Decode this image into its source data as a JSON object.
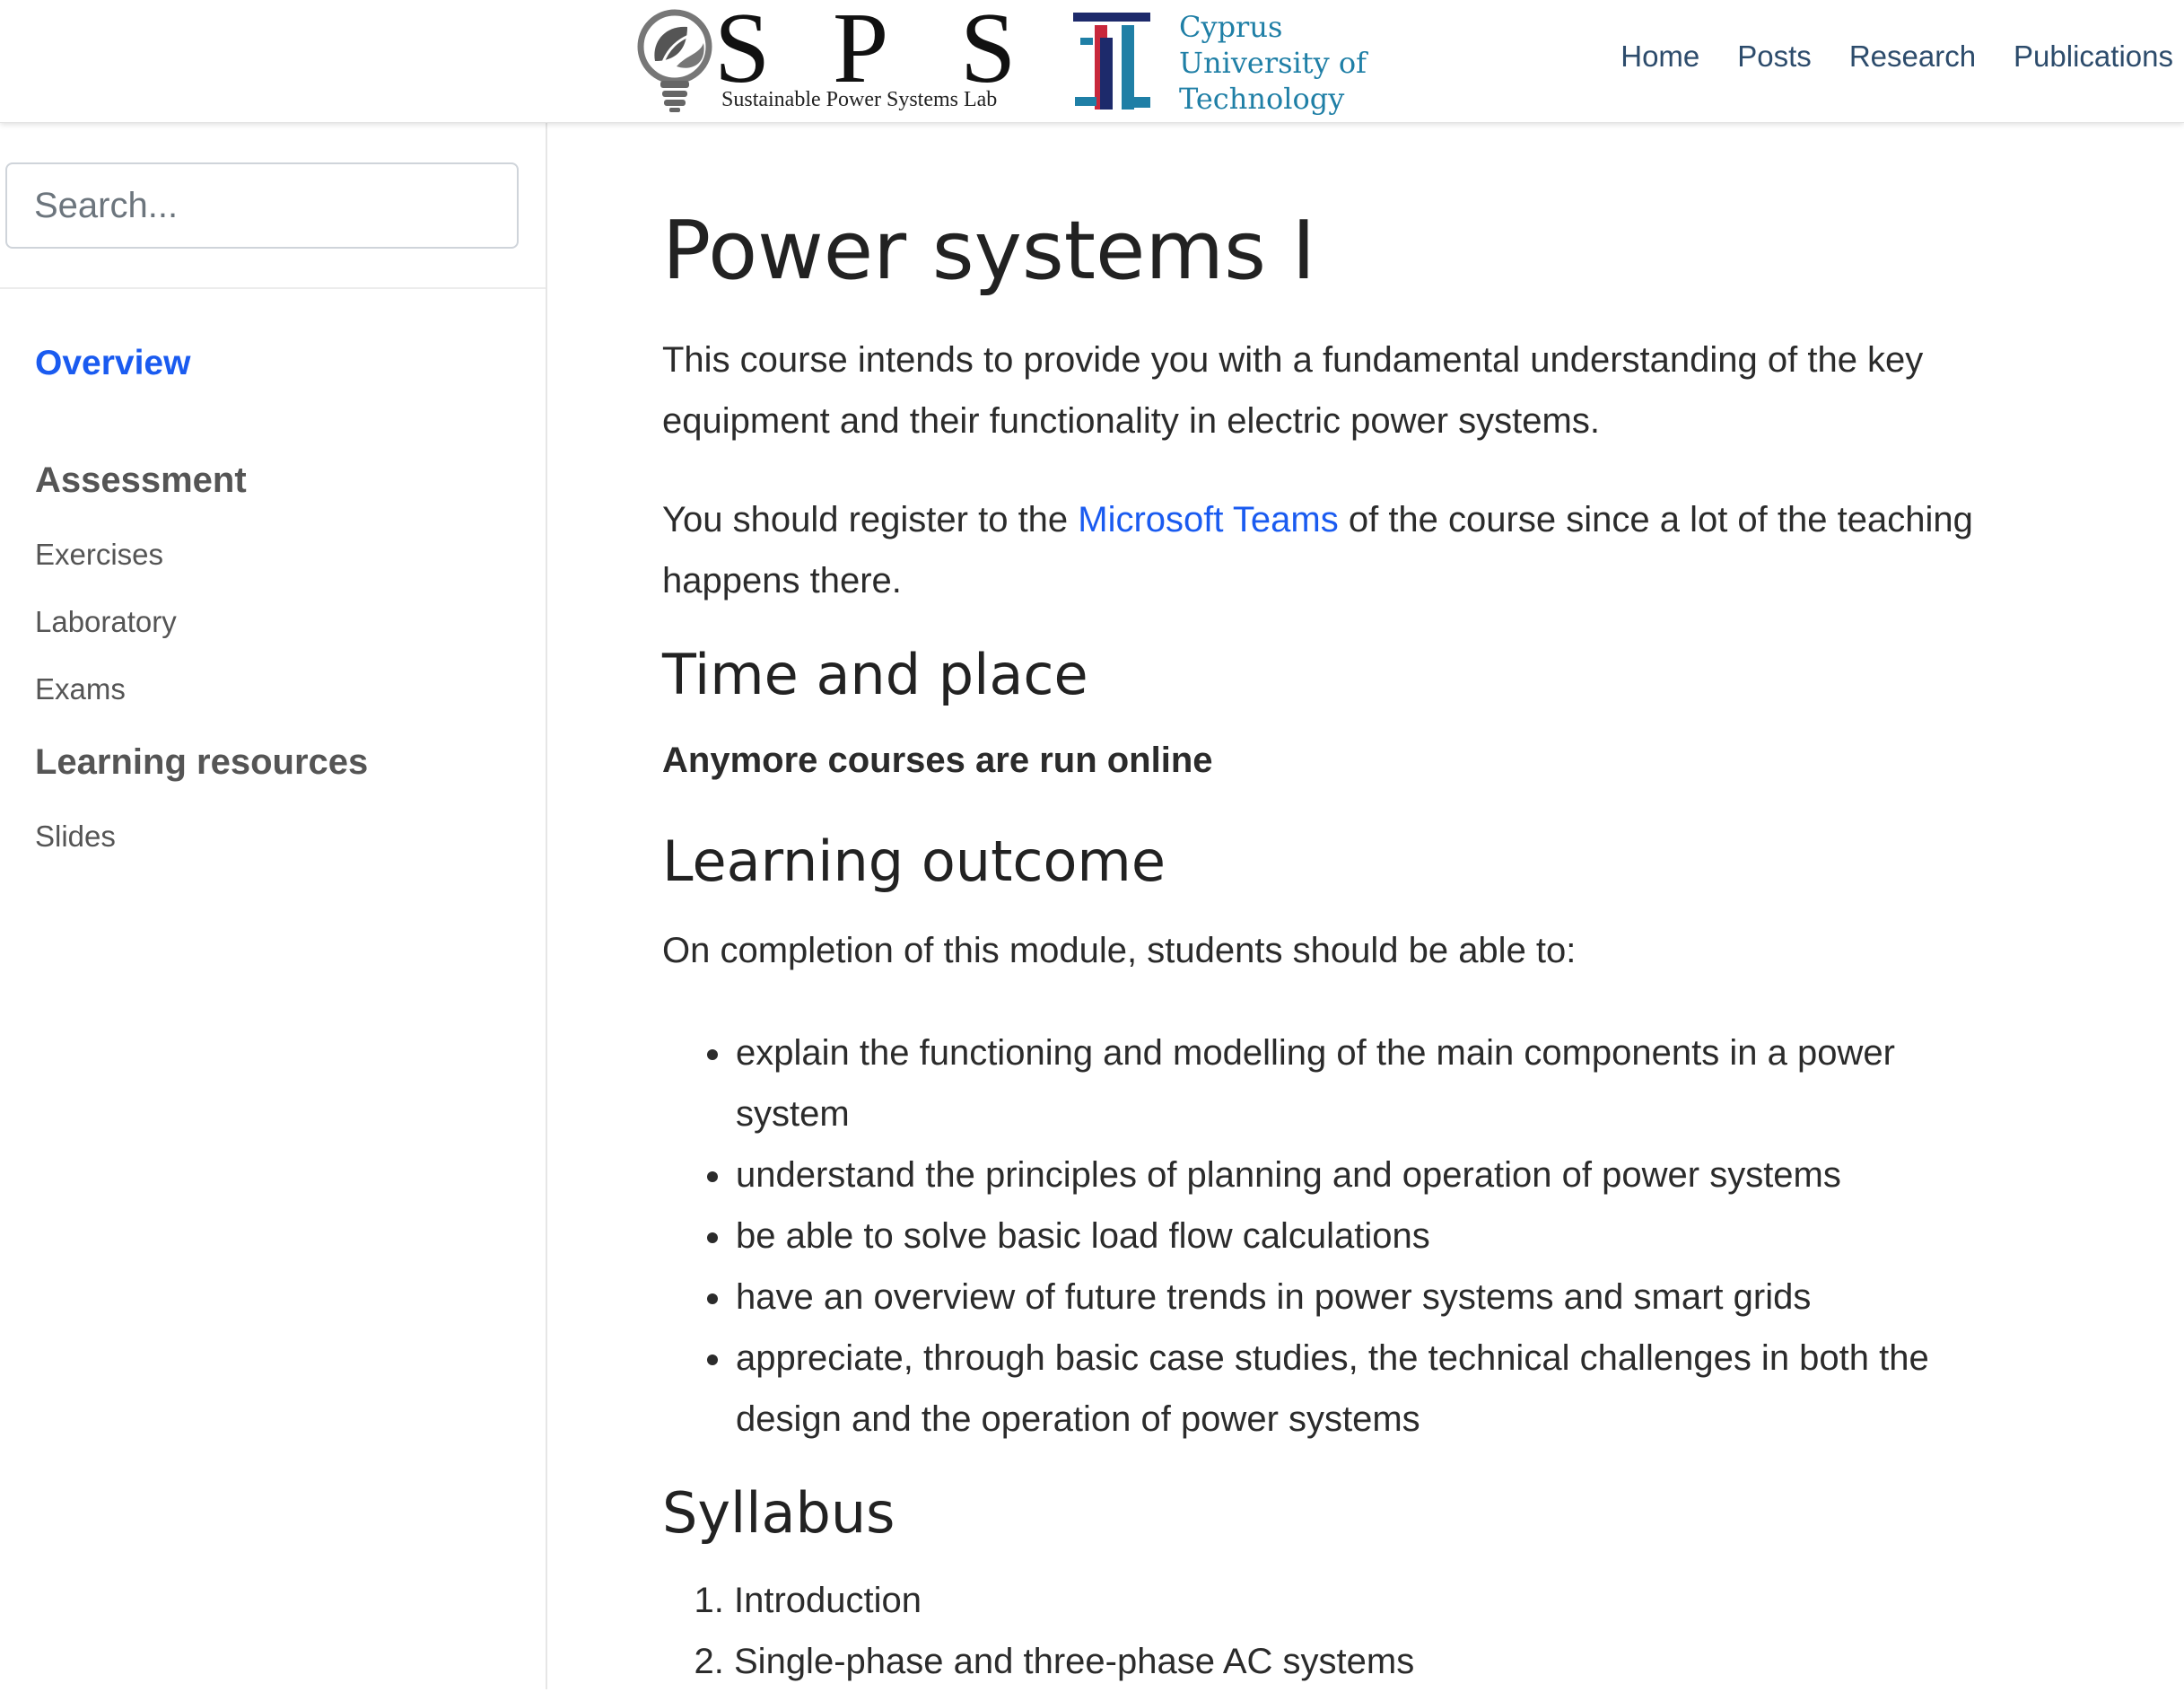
{
  "header": {
    "sps_logo": {
      "letters": [
        "S",
        "P",
        "S"
      ],
      "subtitle": "Sustainable Power Systems Lab"
    },
    "university_logo": {
      "lines": [
        "Cyprus",
        "University of",
        "Technology"
      ]
    },
    "nav": [
      {
        "label": "Home"
      },
      {
        "label": "Posts"
      },
      {
        "label": "Research"
      },
      {
        "label": "Publications"
      }
    ]
  },
  "sidebar": {
    "search_placeholder": "Search...",
    "overview_label": "Overview",
    "sections": [
      {
        "title": "Assessment",
        "items": [
          "Exercises",
          "Laboratory",
          "Exams"
        ]
      },
      {
        "title": "Learning resources",
        "items": [
          "Slides"
        ]
      }
    ]
  },
  "content": {
    "title": "Power systems I",
    "intro": "This course intends to provide you with a fundamental understanding of the key equipment and their functionality in electric power systems.",
    "teams_before": "You should register to the ",
    "teams_link": "Microsoft Teams",
    "teams_after": " of the course since a lot of the teaching happens there.",
    "time_heading": "Time and place",
    "time_note": "Anymore courses are run online",
    "outcome_heading": "Learning outcome",
    "outcome_intro": "On completion of this module, students should be able to:",
    "outcomes": [
      "explain the functioning and modelling of the main components in a power system",
      "understand the principles of planning and operation of power systems",
      "be able to solve basic load flow calculations",
      "have an overview of future trends in power systems and smart grids",
      "appreciate, through basic case studies, the technical challenges in both the design and the operation of power systems"
    ],
    "syllabus_heading": "Syllabus",
    "syllabus": [
      "Introduction",
      "Single-phase and three-phase AC systems"
    ]
  },
  "colors": {
    "link": "#1a5bf0",
    "nav_text": "#2d4c6c",
    "cut_teal": "#1f7fa6",
    "cut_red": "#c8283c",
    "cut_navy": "#1d2a6b"
  }
}
